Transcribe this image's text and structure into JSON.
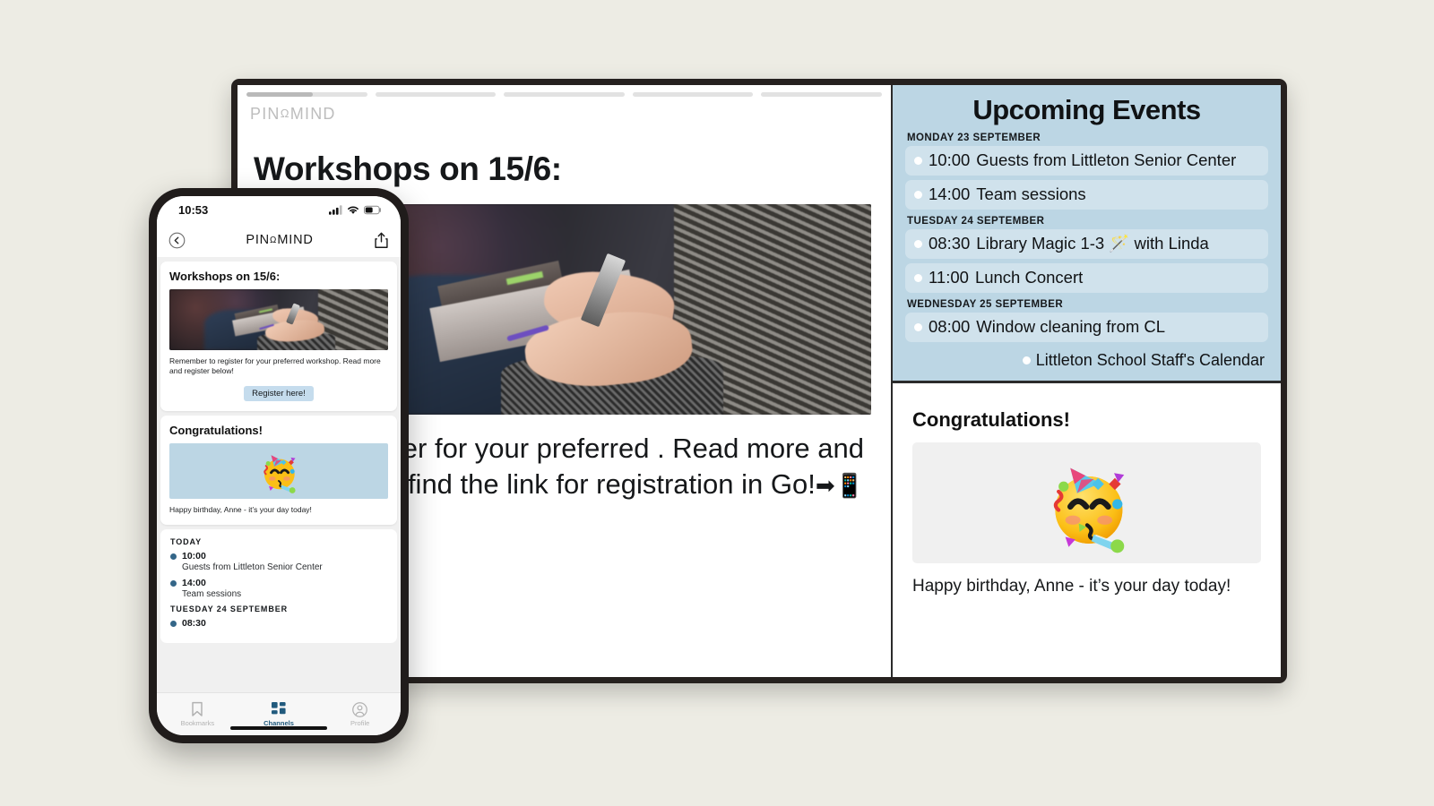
{
  "background_color": "#edece4",
  "accent_color": "#bcd6e4",
  "display": {
    "brand": "PIN°MIND",
    "progress_segments": 5,
    "progress_active_index": 0,
    "progress_active_fill_percent": 55,
    "post": {
      "title": "Workshops on 15/6:",
      "body": "Remember to register for your preferred workshop. Read more and find the link for registration in Go!",
      "body_visible_text": "er to register for your preferred . Read more and find the link for registration in Go!",
      "trailing_emoji": "➡📱",
      "image_alt": "workshop-attendees-taking-notes"
    },
    "events": {
      "title": "Upcoming Events",
      "groups": [
        {
          "day": "MONDAY 23 SEPTEMBER",
          "items": [
            {
              "time": "10:00",
              "text": "Guests from Littleton Senior Center"
            },
            {
              "time": "14:00",
              "text": "Team sessions"
            }
          ]
        },
        {
          "day": "TUESDAY 24 SEPTEMBER",
          "items": [
            {
              "time": "08:30",
              "text": "Library Magic 1-3 🪄 with Linda"
            },
            {
              "time": "11:00",
              "text": "Lunch Concert"
            }
          ]
        },
        {
          "day": "WEDNESDAY 25 SEPTEMBER",
          "items": [
            {
              "time": "08:00",
              "text": "Window cleaning from CL"
            }
          ]
        }
      ],
      "calendar_name": "Littleton School Staff's Calendar"
    },
    "congrats": {
      "title": "Congratulations!",
      "caption": "Happy birthday, Anne - it’s your day today!",
      "image_alt": "partying-face-emoji"
    }
  },
  "phone": {
    "status": {
      "time": "10:53",
      "cellular_icon": "signal-bars-icon",
      "wifi_icon": "wifi-icon",
      "battery_icon": "battery-icon"
    },
    "nav": {
      "back_icon": "back-circle-icon",
      "title": "PIN°MIND",
      "share_icon": "share-icon"
    },
    "cards": [
      {
        "title": "Workshops on 15/6:",
        "text": "Remember to register for your preferred workshop. Read more and register below!",
        "button": "Register here!",
        "image_alt": "workshop-attendees-taking-notes"
      },
      {
        "title": "Congratulations!",
        "text": "Happy birthday, Anne - it’s your day today!",
        "image_alt": "partying-face-emoji"
      }
    ],
    "agenda": {
      "groups": [
        {
          "day": "TODAY",
          "items": [
            {
              "time": "10:00",
              "desc": "Guests from Littleton Senior Center"
            },
            {
              "time": "14:00",
              "desc": "Team sessions"
            }
          ]
        },
        {
          "day": "TUESDAY 24 SEPTEMBER",
          "items": [
            {
              "time": "08:30",
              "desc": ""
            }
          ]
        }
      ]
    },
    "tabs": [
      {
        "label": "Bookmarks",
        "icon": "bookmark-icon",
        "active": false
      },
      {
        "label": "Channels",
        "icon": "grid-icon",
        "active": true
      },
      {
        "label": "Profile",
        "icon": "person-circle-icon",
        "active": false
      }
    ]
  }
}
